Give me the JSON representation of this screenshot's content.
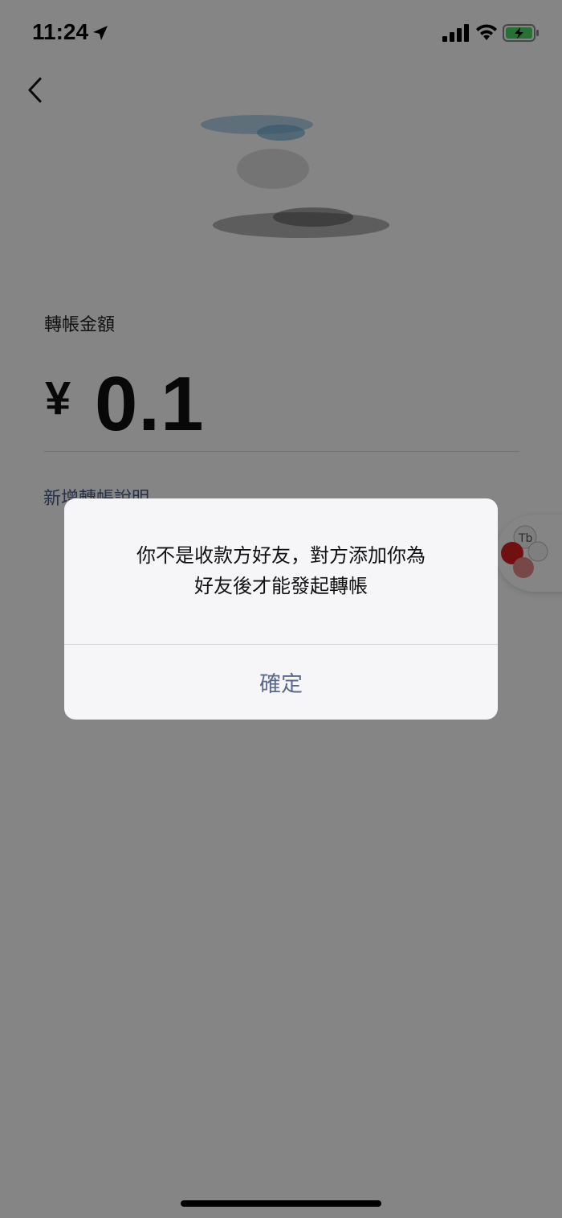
{
  "status_bar": {
    "time": "11:24",
    "icons": [
      "location-arrow-icon",
      "cellular-signal-icon",
      "wifi-icon",
      "battery-charging-icon"
    ],
    "battery_color": "#4cd964"
  },
  "transfer": {
    "amount_label": "轉帳金額",
    "currency_symbol": "¥",
    "amount": "0.1",
    "add_note_link": "新增轉帳說明",
    "link_color": "#4a5a86"
  },
  "alert": {
    "message_line1": "你不是收款方好友，對方添加你為",
    "message_line2": "好友後才能發起轉帳",
    "confirm_label": "確定",
    "confirm_color": "#5a6a8e"
  }
}
